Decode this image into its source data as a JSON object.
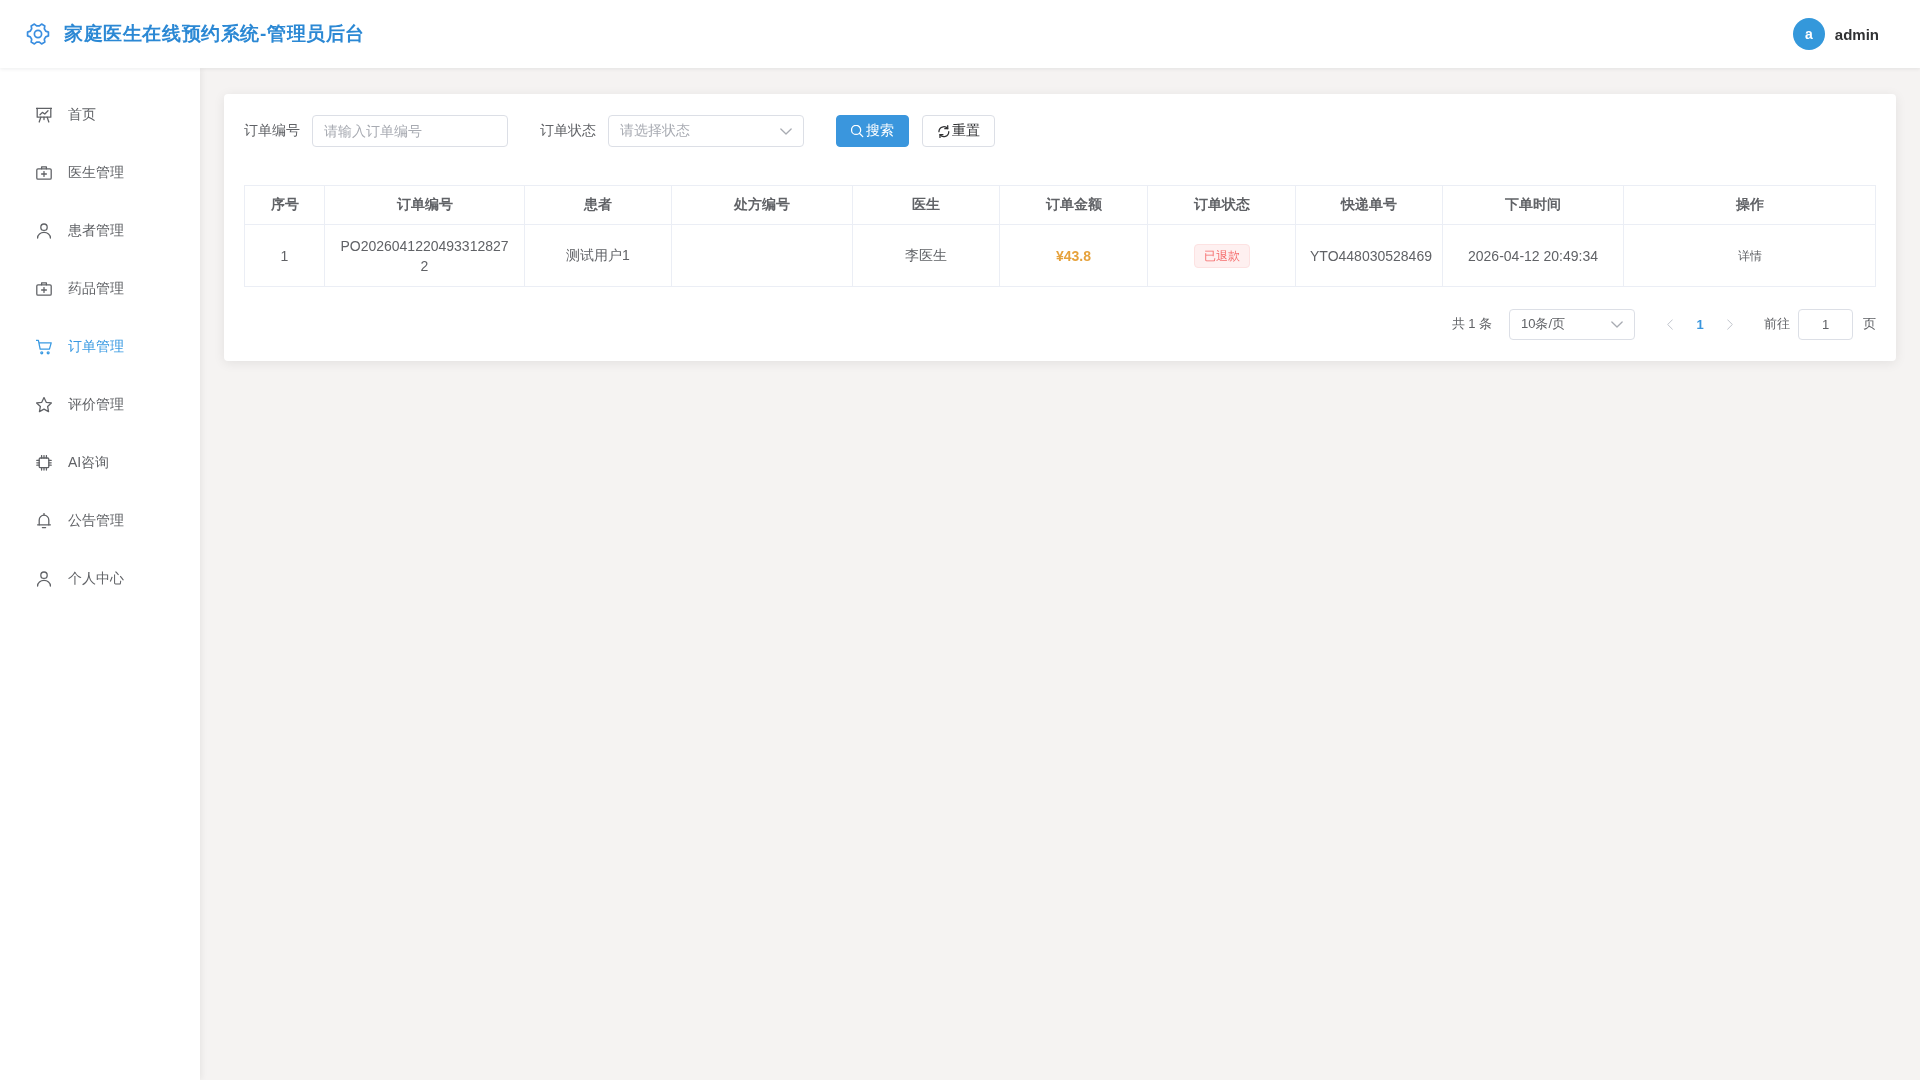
{
  "header": {
    "title": "家庭医生在线预约系统-管理员后台",
    "user": {
      "avatar_text": "a",
      "name": "admin"
    }
  },
  "sidebar": {
    "items": [
      {
        "label": "首页",
        "selected": false
      },
      {
        "label": "医生管理",
        "selected": false
      },
      {
        "label": "患者管理",
        "selected": false
      },
      {
        "label": "药品管理",
        "selected": false
      },
      {
        "label": "订单管理",
        "selected": true
      },
      {
        "label": "评价管理",
        "selected": false
      },
      {
        "label": "AI咨询",
        "selected": false
      },
      {
        "label": "公告管理",
        "selected": false
      },
      {
        "label": "个人中心",
        "selected": false
      }
    ]
  },
  "search_form": {
    "fields": [
      {
        "kind": "input",
        "label": "订单编号",
        "placeholder": "请输入订单编号"
      },
      {
        "kind": "select",
        "label": "订单状态",
        "placeholder": "请选择状态"
      }
    ],
    "buttons": [
      {
        "kind": "primary",
        "label": "搜索"
      },
      {
        "kind": "default",
        "label": "重置"
      }
    ]
  },
  "table": {
    "columns": [
      "序号",
      "订单编号",
      "患者",
      "处方编号",
      "医生",
      "订单金额",
      "订单状态",
      "快递单号",
      "下单时间",
      "操作"
    ],
    "rows": [
      {
        "index": "1",
        "order_no": "PO20260412204933128272",
        "patient": "测试用户1",
        "doctor": "李医生",
        "amount": "¥43.8",
        "status": {
          "label": "已退款",
          "kind": "danger"
        },
        "tracking_no": "YTO448030528469",
        "order_time": "2026-04-12 20:49:34",
        "actions": [
          "详情"
        ]
      }
    ]
  },
  "pagination": {
    "total": "共 1 条",
    "page_size": "10条/页",
    "prev_disabled": true,
    "pages": [
      {
        "label": "1",
        "selected": true
      }
    ],
    "next_disabled": true,
    "jump_label": "前往",
    "jump_value": "1",
    "jump_suffix": "页"
  }
}
